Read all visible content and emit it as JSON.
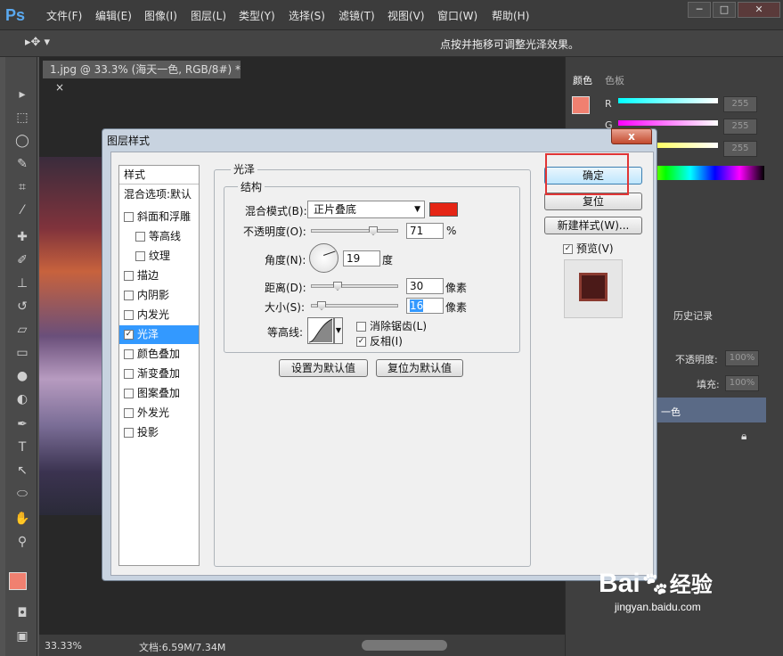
{
  "app": {
    "logo": "Ps"
  },
  "menu": [
    "文件(F)",
    "编辑(E)",
    "图像(I)",
    "图层(L)",
    "类型(Y)",
    "选择(S)",
    "滤镜(T)",
    "视图(V)",
    "窗口(W)",
    "帮助(H)"
  ],
  "window_controls": {
    "min": "─",
    "max": "□",
    "close": "✕"
  },
  "options_bar": {
    "hint": "点按并拖移可调整光泽效果。",
    "tool_icon": "move-icon"
  },
  "document": {
    "tab_title": "1.jpg @ 33.3% (海天一色, RGB/8#) *",
    "tab_close": "×"
  },
  "status": {
    "zoom": "33.33%",
    "doc_size": "文档:6.59M/7.34M"
  },
  "color_panel": {
    "tab_color": "颜色",
    "tab_swatches": "色板",
    "r_label": "R",
    "g_label": "G",
    "b_label": "B",
    "r": "255",
    "g": "255",
    "b": "255"
  },
  "layers_panel": {
    "tab_history": "历史记录",
    "opacity_label": "不透明度:",
    "opacity_value": "100%",
    "fill_label": "填充:",
    "fill_value": "100%",
    "layer_name": "一色"
  },
  "dialog": {
    "title": "图层样式",
    "close": "x",
    "styles_header": "样式",
    "blend_options": "混合选项:默认",
    "styles": [
      {
        "label": "斜面和浮雕",
        "checked": false,
        "indent": false
      },
      {
        "label": "等高线",
        "checked": false,
        "indent": true
      },
      {
        "label": "纹理",
        "checked": false,
        "indent": true
      },
      {
        "label": "描边",
        "checked": false,
        "indent": false
      },
      {
        "label": "内阴影",
        "checked": false,
        "indent": false
      },
      {
        "label": "内发光",
        "checked": false,
        "indent": false
      },
      {
        "label": "光泽",
        "checked": true,
        "indent": false,
        "selected": true
      },
      {
        "label": "颜色叠加",
        "checked": false,
        "indent": false
      },
      {
        "label": "渐变叠加",
        "checked": false,
        "indent": false
      },
      {
        "label": "图案叠加",
        "checked": false,
        "indent": false
      },
      {
        "label": "外发光",
        "checked": false,
        "indent": false
      },
      {
        "label": "投影",
        "checked": false,
        "indent": false
      }
    ],
    "satin": {
      "group_title": "光泽",
      "structure_title": "结构",
      "blend_mode_label": "混合模式(B):",
      "blend_mode_value": "正片叠底",
      "blend_color": "#e52515",
      "opacity_label": "不透明度(O):",
      "opacity_value": "71",
      "opacity_unit": "%",
      "angle_label": "角度(N):",
      "angle_value": "19",
      "angle_unit": "度",
      "distance_label": "距离(D):",
      "distance_value": "30",
      "distance_unit": "像素",
      "size_label": "大小(S):",
      "size_value": "16",
      "size_unit": "像素",
      "contour_label": "等高线:",
      "anti_alias_label": "消除锯齿(L)",
      "anti_alias_checked": false,
      "invert_label": "反相(I)",
      "invert_checked": true,
      "make_default": "设置为默认值",
      "reset_default": "复位为默认值"
    },
    "buttons": {
      "ok": "确定",
      "reset": "复位",
      "new_style": "新建样式(W)...",
      "preview_label": "预览(V)",
      "preview_checked": true
    }
  },
  "watermark": {
    "brand": "Bai",
    "suffix": "经验",
    "url": "jingyan.baidu.com"
  }
}
